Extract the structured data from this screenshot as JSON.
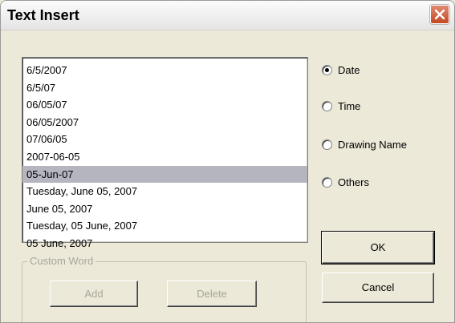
{
  "window": {
    "title": "Text Insert"
  },
  "list": {
    "items": [
      "6/5/2007",
      "6/5/07",
      "06/05/07",
      "06/05/2007",
      "07/06/05",
      "2007-06-05",
      "05-Jun-07",
      "Tuesday, June 05, 2007",
      "June 05, 2007",
      "Tuesday, 05 June, 2007",
      "05 June, 2007"
    ],
    "selected_value": "05-Jun-07"
  },
  "options": {
    "date": "Date",
    "time": "Time",
    "drawing_name": "Drawing Name",
    "others": "Others",
    "selected": "Date"
  },
  "buttons": {
    "ok": "OK",
    "cancel": "Cancel"
  },
  "custom_word": {
    "label": "Custom Word",
    "add": "Add",
    "delete": "Delete"
  }
}
